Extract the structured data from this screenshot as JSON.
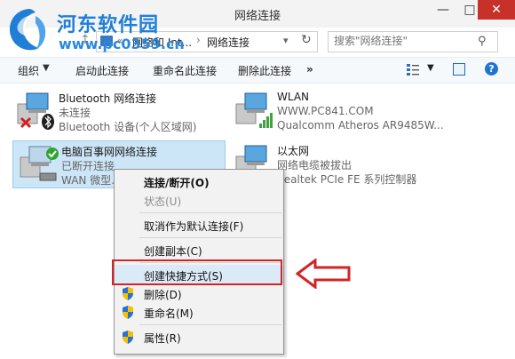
{
  "window": {
    "title": "网络连接",
    "minimize": "—",
    "maximize": "□",
    "close": "✕"
  },
  "watermark": {
    "site_name": "河东软件园",
    "url": "www.pc0359.cn"
  },
  "address": {
    "crumbs": [
      "网络和 Int...",
      "网络连接"
    ],
    "separator": "›",
    "search_placeholder": "搜索\"网络连接\""
  },
  "toolbar": {
    "organize": "组织",
    "actions": [
      "启动此连接",
      "重命名此连接",
      "删除此连接"
    ],
    "more": "»"
  },
  "connections": [
    {
      "name": "Bluetooth 网络连接",
      "status": "未连接",
      "device": "Bluetooth 设备(个人区域网)",
      "icon": "network-computer-bluetooth-disconnected-icon"
    },
    {
      "name": "WLAN",
      "status": "WWW.PC841.COM",
      "device": "Qualcomm Atheros AR9485W...",
      "icon": "network-computer-wlan-signal-icon"
    },
    {
      "name": "电脑百事网网络连接",
      "status": "已断开连接",
      "device": "WAN 微型...",
      "icon": "network-computer-wan-icon",
      "selected": true
    },
    {
      "name": "以太网",
      "status": "网络电缆被拔出",
      "device": "Realtek PCIe FE 系列控制器",
      "icon": "network-computer-ethernet-unplugged-icon"
    }
  ],
  "context_menu": {
    "items": [
      {
        "label": "连接/断开(O)",
        "bold": true,
        "disabled": false,
        "shield": false
      },
      {
        "label": "状态(U)",
        "bold": false,
        "disabled": true,
        "shield": false
      },
      {
        "label": "取消作为默认连接(F)",
        "bold": false,
        "disabled": false,
        "shield": false
      },
      {
        "label": "创建副本(C)",
        "bold": false,
        "disabled": false,
        "shield": false
      },
      {
        "label": "创建快捷方式(S)",
        "bold": false,
        "disabled": false,
        "shield": false,
        "highlighted": true
      },
      {
        "label": "删除(D)",
        "bold": false,
        "disabled": false,
        "shield": true
      },
      {
        "label": "重命名(M)",
        "bold": false,
        "disabled": false,
        "shield": true
      },
      {
        "label": "属性(R)",
        "bold": false,
        "disabled": false,
        "shield": true
      }
    ]
  },
  "colors": {
    "annotation_red": "#d02525",
    "selection_blue": "#cde6f7",
    "close_button": "#c7312a"
  }
}
